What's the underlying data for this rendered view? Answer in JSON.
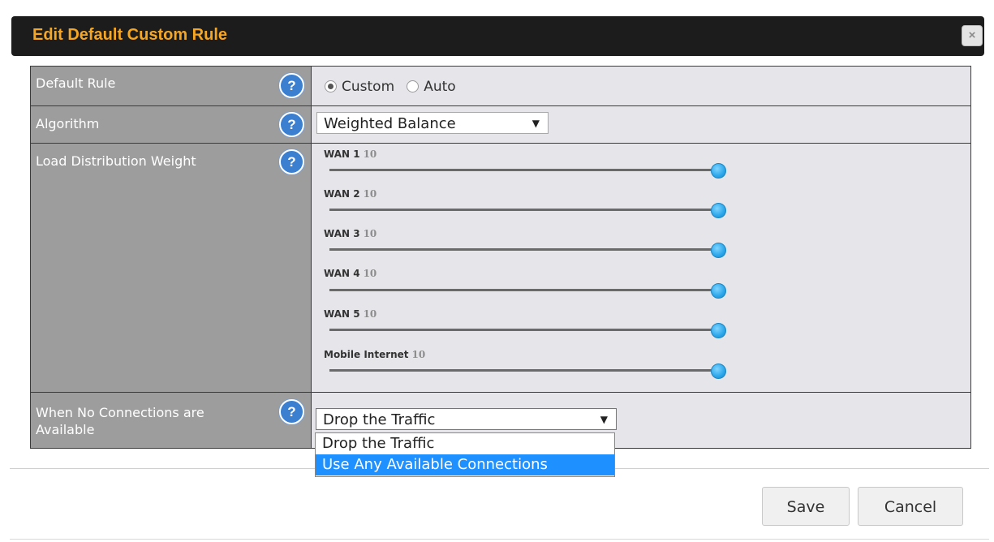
{
  "dialog": {
    "title": "Edit Default Custom Rule",
    "close_icon": "×"
  },
  "rows": {
    "default_rule": {
      "label": "Default Rule",
      "options": [
        {
          "label": "Custom",
          "selected": true
        },
        {
          "label": "Auto",
          "selected": false
        }
      ]
    },
    "algorithm": {
      "label": "Algorithm",
      "value": "Weighted Balance"
    },
    "load_distribution": {
      "label": "Load Distribution Weight",
      "sliders": [
        {
          "name": "WAN 1",
          "value": "10"
        },
        {
          "name": "WAN 2",
          "value": "10"
        },
        {
          "name": "WAN 3",
          "value": "10"
        },
        {
          "name": "WAN 4",
          "value": "10"
        },
        {
          "name": "WAN 5",
          "value": "10"
        },
        {
          "name": "Mobile Internet",
          "value": "10"
        }
      ]
    },
    "no_connections": {
      "label_line1": "When No Connections are",
      "label_line2": "Available",
      "value": "Drop the Traffic",
      "dropdown_options": [
        "Drop the Traffic",
        "Use Any Available Connections"
      ],
      "highlighted_option": "Use Any Available Connections"
    }
  },
  "help_icon": "?",
  "arrow_icon": "▼",
  "buttons": {
    "save": "Save",
    "cancel": "Cancel"
  },
  "colors": {
    "title_text": "#f5a623",
    "title_bar": "#1c1c1c",
    "label_bg": "#9d9d9d",
    "value_bg": "#e6e6ea",
    "help_icon": "#3a7fd0",
    "highlight": "#1e90ff"
  }
}
